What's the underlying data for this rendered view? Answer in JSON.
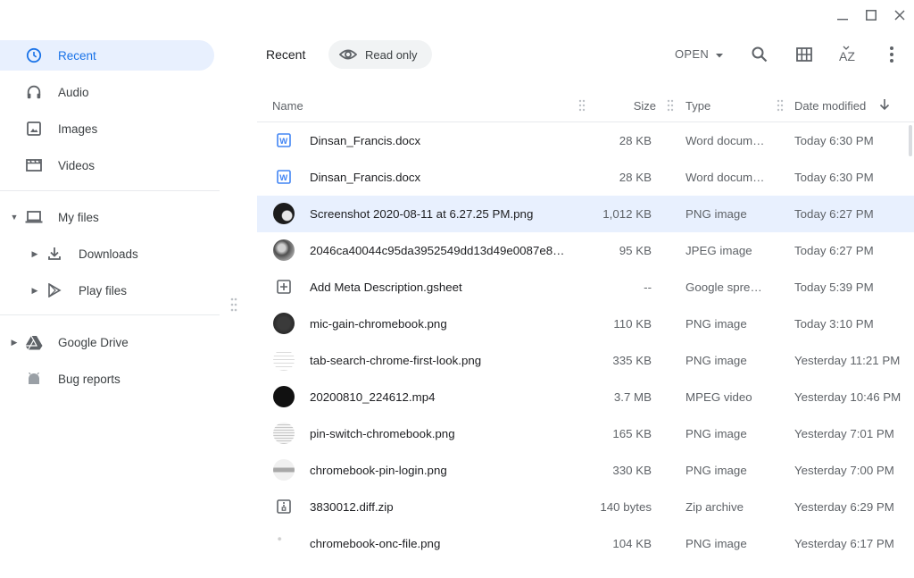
{
  "window": {
    "minimize_icon": "minimize-icon",
    "maximize_icon": "maximize-icon",
    "close_icon": "close-icon"
  },
  "sidebar": {
    "recent": "Recent",
    "audio": "Audio",
    "images": "Images",
    "videos": "Videos",
    "my_files": "My files",
    "downloads": "Downloads",
    "play_files": "Play files",
    "google_drive": "Google Drive",
    "bug_reports": "Bug reports"
  },
  "toolbar": {
    "title": "Recent",
    "chip_label": "Read only",
    "open_label": "OPEN",
    "sort_label": "AZ"
  },
  "table": {
    "headers": {
      "name": "Name",
      "size": "Size",
      "type": "Type",
      "date": "Date modified"
    },
    "rows": [
      {
        "name": "Dinsan_Francis.docx",
        "size": "28 KB",
        "type": "Word docum…",
        "date": "Today 6:30 PM",
        "icon": "word-doc-icon"
      },
      {
        "name": "Dinsan_Francis.docx",
        "size": "28 KB",
        "type": "Word docum…",
        "date": "Today 6:30 PM",
        "icon": "word-doc-icon"
      },
      {
        "name": "Screenshot 2020-08-11 at 6.27.25 PM.png",
        "size": "1,012 KB",
        "type": "PNG image",
        "date": "Today 6:27 PM",
        "icon": "image-thumbnail",
        "selected": true
      },
      {
        "name": "2046ca40044c95da3952549dd13d49e0087e8…",
        "size": "95 KB",
        "type": "JPEG image",
        "date": "Today 6:27 PM",
        "icon": "image-thumbnail"
      },
      {
        "name": "Add Meta Description.gsheet",
        "size": "--",
        "type": "Google sprea…",
        "date": "Today 5:39 PM",
        "icon": "gsheet-icon"
      },
      {
        "name": "mic-gain-chromebook.png",
        "size": "110 KB",
        "type": "PNG image",
        "date": "Today 3:10 PM",
        "icon": "image-thumbnail"
      },
      {
        "name": "tab-search-chrome-first-look.png",
        "size": "335 KB",
        "type": "PNG image",
        "date": "Yesterday 11:21 PM",
        "icon": "image-thumbnail"
      },
      {
        "name": "20200810_224612.mp4",
        "size": "3.7 MB",
        "type": "MPEG video",
        "date": "Yesterday 10:46 PM",
        "icon": "video-thumbnail"
      },
      {
        "name": "pin-switch-chromebook.png",
        "size": "165 KB",
        "type": "PNG image",
        "date": "Yesterday 7:01 PM",
        "icon": "image-thumbnail"
      },
      {
        "name": "chromebook-pin-login.png",
        "size": "330 KB",
        "type": "PNG image",
        "date": "Yesterday 7:00 PM",
        "icon": "image-thumbnail"
      },
      {
        "name": "3830012.diff.zip",
        "size": "140 bytes",
        "type": "Zip archive",
        "date": "Yesterday 6:29 PM",
        "icon": "zip-icon"
      },
      {
        "name": "chromebook-onc-file.png",
        "size": "104 KB",
        "type": "PNG image",
        "date": "Yesterday 6:17 PM",
        "icon": "image-thumbnail"
      }
    ]
  },
  "colors": {
    "accent": "#1a73e8",
    "selected_bg": "#e8f0fe",
    "word_blue": "#4285f4"
  }
}
